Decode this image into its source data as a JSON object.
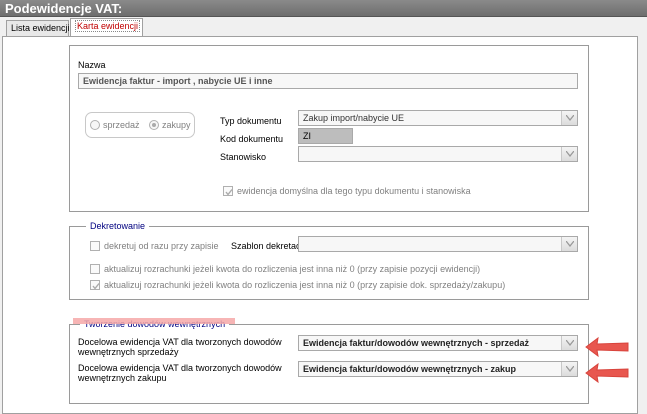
{
  "window": {
    "title": "Podewidencje VAT:"
  },
  "tabs": [
    {
      "label": "Lista ewidencji",
      "active": false
    },
    {
      "label": "Karta ewidencji",
      "active": true
    }
  ],
  "main": {
    "name_label": "Nazwa",
    "name_value": "Ewidencja faktur - import , nabycie UE i inne",
    "radio_sprzedaz": "sprzedaż",
    "radio_zakupy": "zakupy",
    "typ_label": "Typ dokumentu",
    "typ_value": "Zakup import/nabycie UE",
    "kod_label": "Kod dokumentu",
    "kod_value": "ZI",
    "stanowisko_label": "Stanowisko",
    "stanowisko_value": "",
    "domyslna_label": "ewidencja domyślna dla tego typu dokumentu i stanowiska",
    "domyslna_checked": true
  },
  "dekretowanie": {
    "title": "Dekretowanie",
    "dekretuj_label": "dekretuj od razu przy zapisie",
    "dekretuj_checked": false,
    "szablon_label": "Szablon dekretacji",
    "szablon_value": "",
    "aktualizuj1_label": "aktualizuj rozrachunki jeżeli kwota do rozliczenia jest inna niż 0 (przy zapisie pozycji ewidencji)",
    "aktualizuj1_checked": false,
    "aktualizuj2_label": "aktualizuj rozrachunki jeżeli kwota do rozliczenia jest inna niż 0 (przy zapisie dok. sprzedaży/zakupu)",
    "aktualizuj2_checked": true
  },
  "tworzenie": {
    "title": "Tworzenie dowodów wewnętrznych",
    "sprzedaz_label_1": "Docelowa ewidencja VAT dla tworzonych dowodów",
    "sprzedaz_label_2": "wewnętrznych sprzedaży",
    "sprzedaz_value": "Ewidencja faktur/dowodów wewnętrznych - sprzedaż",
    "zakup_label_1": "Docelowa ewidencja VAT dla tworzonych dowodów",
    "zakup_label_2": "wewnętrznych zakupu",
    "zakup_value": "Ewidencja faktur/dowodów wewnętrznych - zakup"
  },
  "colors": {
    "title_bar": "#7a7a7a",
    "group_title": "#000080",
    "active_tab_text": "#c00000",
    "annotation_arrow": "#e8574f",
    "annotation_highlight": "#f6a8a8"
  }
}
